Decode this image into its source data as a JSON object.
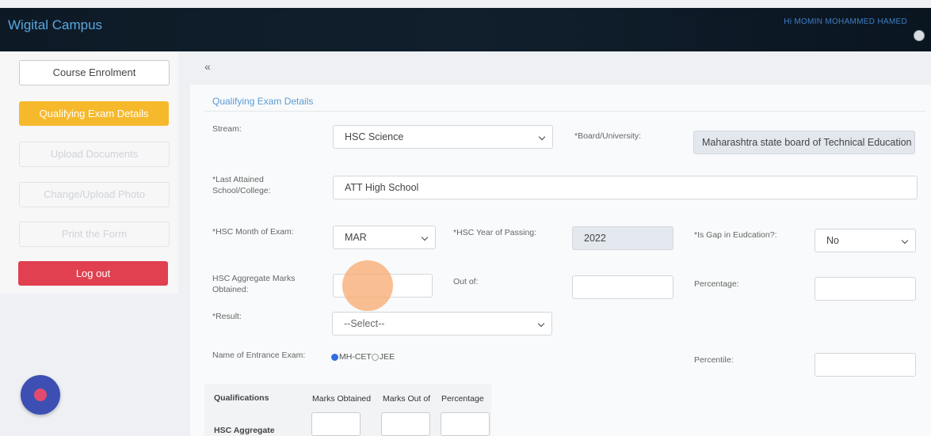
{
  "header": {
    "brand": "Wigital Campus",
    "user": "Hi MOMIN MOHAMMED HAMED"
  },
  "sidebar": {
    "items": [
      {
        "label": "Course Enrolment"
      },
      {
        "label": "Qualifying Exam Details"
      },
      {
        "label": "Upload Documents"
      },
      {
        "label": "Change/Upload Photo"
      },
      {
        "label": "Print the Form"
      },
      {
        "label": "Log out"
      }
    ]
  },
  "main": {
    "collapse": "«",
    "title": "Qualifying Exam Details",
    "stream": {
      "label": "Stream:",
      "value": "HSC Science"
    },
    "board": {
      "label": "*Board/University:",
      "value": "Maharashtra state board of Technical Education"
    },
    "school": {
      "label": "*Last Attained School/College:",
      "value": "ATT High School"
    },
    "month": {
      "label": "*HSC Month of Exam:",
      "value": "MAR"
    },
    "year": {
      "label": "*HSC Year of Passing:",
      "value": "2022"
    },
    "gap": {
      "label": "*Is Gap in Eudcation?:",
      "value": "No"
    },
    "marks": {
      "label": "HSC Aggregate Marks Obtained:",
      "value": ""
    },
    "outof": {
      "label": "Out of:",
      "value": ""
    },
    "percentage": {
      "label": "Percentage:",
      "value": ""
    },
    "result": {
      "label": "*Result:",
      "value": "--Select--"
    },
    "entrance": {
      "label": "Name of Entrance Exam:",
      "options": [
        "MH-CET",
        "JEE"
      ],
      "selected": "MH-CET"
    },
    "percentile": {
      "label": "Percentile:",
      "value": ""
    }
  },
  "qualifications": {
    "headers": [
      "Qualifications",
      "Marks Obtained",
      "Marks Out of",
      "Percentage"
    ],
    "rows": [
      {
        "name": "HSC Aggregate"
      }
    ]
  }
}
